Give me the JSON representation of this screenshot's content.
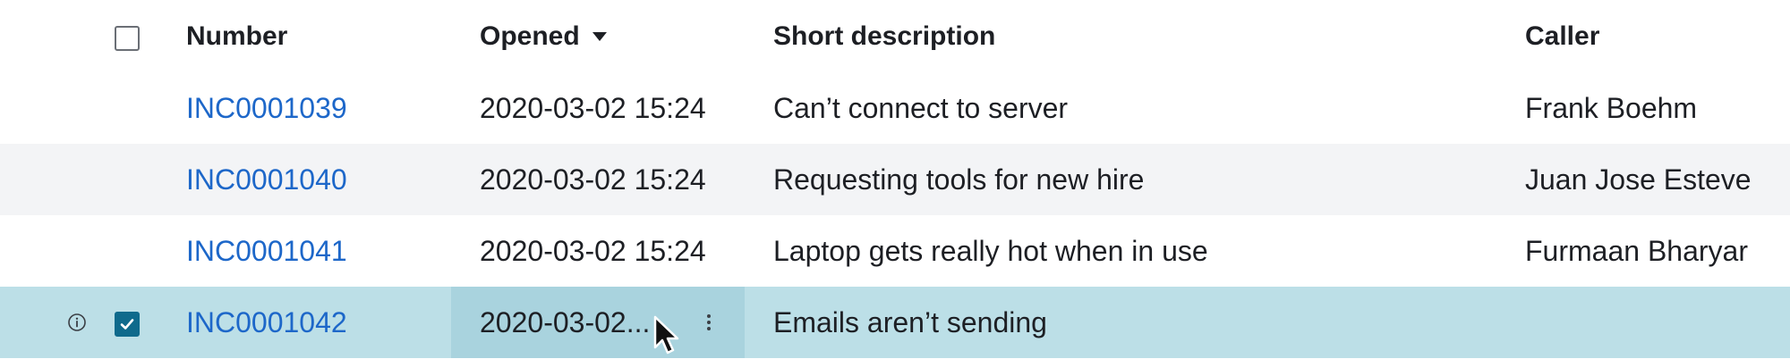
{
  "columns": {
    "number": "Number",
    "opened": "Opened",
    "short_description": "Short description",
    "caller": "Caller"
  },
  "rows": [
    {
      "number": "INC0001039",
      "opened": "2020-03-02 15:24",
      "short_description": "Can’t connect to server",
      "caller": "Frank Boehm"
    },
    {
      "number": "INC0001040",
      "opened": "2020-03-02 15:24",
      "short_description": "Requesting tools for new hire",
      "caller": "Juan Jose Esteve"
    },
    {
      "number": "INC0001041",
      "opened": "2020-03-02 15:24",
      "short_description": "Laptop gets really hot when in use",
      "caller": "Furmaan Bharyar"
    },
    {
      "number": "INC0001042",
      "opened": "2020-03-02...",
      "short_description": "Emails aren’t sending",
      "caller": "",
      "selected": true
    }
  ],
  "icons": {
    "sort": "sort-descending-icon",
    "info": "info-icon",
    "menu": "more-vertical-icon",
    "cursor": "mouse-pointer-icon"
  },
  "colors": {
    "link": "#1d67c9",
    "selected_row": "#bcdfe7",
    "focused_cell": "#a9d3de",
    "checkbox_checked": "#0f6a8c",
    "stripe": "#f3f4f6"
  }
}
